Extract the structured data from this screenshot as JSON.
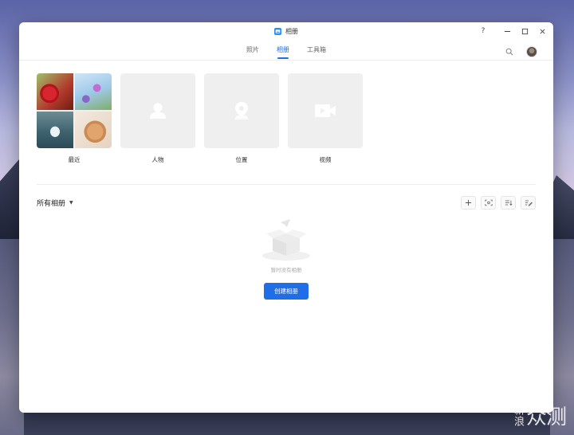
{
  "window": {
    "title": "相册"
  },
  "titlebar": {
    "help": "?"
  },
  "tabs": [
    {
      "label": "照片",
      "active": false
    },
    {
      "label": "相册",
      "active": true
    },
    {
      "label": "工具箱",
      "active": false
    }
  ],
  "categories": [
    {
      "label": "最近"
    },
    {
      "label": "人物"
    },
    {
      "label": "位置"
    },
    {
      "label": "视频"
    }
  ],
  "albums": {
    "title": "所有相册",
    "empty_text": "暂时没有相册",
    "create_label": "创建相册"
  },
  "watermark": {
    "small": "新浪",
    "big": "众测"
  },
  "colors": {
    "accent": "#1f6ee8",
    "app_icon": "#2a8ff2"
  }
}
